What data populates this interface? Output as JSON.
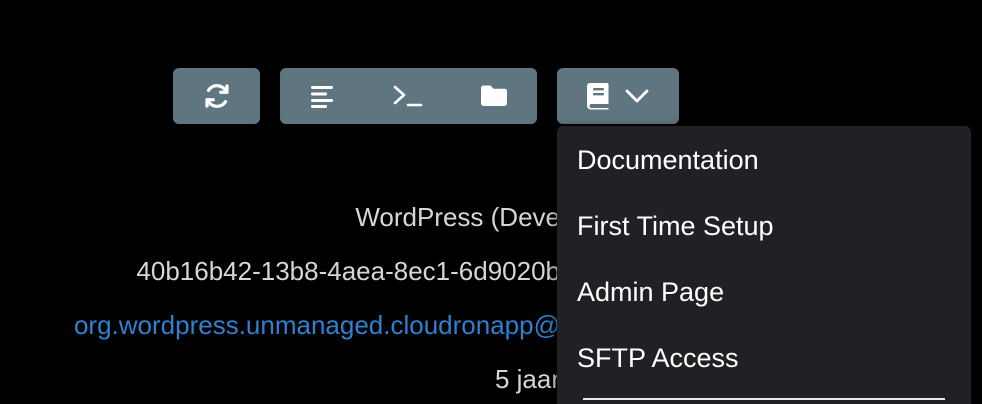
{
  "toolbar": {
    "refresh_icon": "refresh-icon",
    "logs_icon": "logs-icon",
    "terminal_icon": "terminal-icon",
    "files_icon": "folder-icon",
    "docs_icon": "book-icon",
    "dropdown_icon": "chevron-down-icon",
    "button_color": "#5f7580"
  },
  "app_info": {
    "name": "WordPress (Deve",
    "id": "40b16b42-13b8-4aea-8ec1-6d9020b",
    "package": "org.wordpress.unmanaged.cloudronapp@",
    "age": "5 jaar"
  },
  "docs_menu": {
    "items": [
      {
        "label": "Documentation"
      },
      {
        "label": "First Time Setup"
      },
      {
        "label": "Admin Page"
      },
      {
        "label": "SFTP Access"
      }
    ]
  },
  "colors": {
    "background": "#000000",
    "menu_background": "#202124",
    "link": "#2f80d0",
    "text": "#d6d6d6"
  }
}
